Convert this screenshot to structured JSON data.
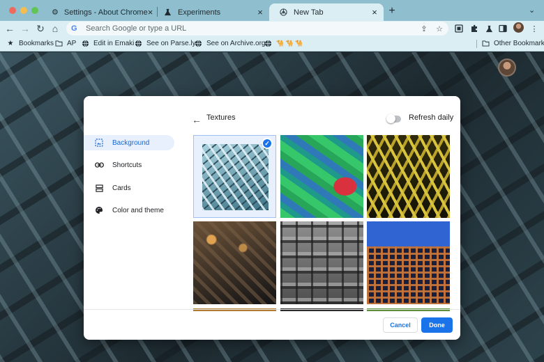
{
  "window": {
    "traffic_lights": {
      "close": "#ee6a5f",
      "minimize": "#f5bd4f",
      "zoom": "#61c454"
    }
  },
  "tabs": [
    {
      "label": "Settings - About Chrome",
      "icon": "gear-icon",
      "active": false
    },
    {
      "label": "Experiments",
      "icon": "flask-icon",
      "active": false
    },
    {
      "label": "New Tab",
      "icon": "chrome-globe-icon",
      "active": true
    }
  ],
  "toolbar": {
    "omnibox_placeholder": "Search Google or type a URL",
    "icons": [
      "back-icon",
      "forward-icon",
      "reload-icon",
      "home-icon",
      "google-g-icon",
      "share-icon",
      "star-icon",
      "extension-a-icon",
      "puzzle-icon",
      "labs-icon",
      "side-panel-icon",
      "avatar",
      "kebab-menu-icon"
    ]
  },
  "bookmarks": {
    "items": [
      {
        "label": "Bookmarks",
        "icon": "star-icon"
      },
      {
        "label": "AP",
        "icon": "folder-icon"
      },
      {
        "label": "Edit in Emaki",
        "icon": "globe-icon"
      },
      {
        "label": "See on Parse.ly",
        "icon": "globe-icon"
      },
      {
        "label": "See on Archive.org",
        "icon": "globe-icon"
      }
    ],
    "extra_glyphs": "🐪 🐪 🐪",
    "other": "Other Bookmarks"
  },
  "customize": {
    "section_title": "Textures",
    "refresh_daily_label": "Refresh daily",
    "refresh_daily_on": false,
    "menu": [
      {
        "label": "Background",
        "icon": "background-icon",
        "selected": true
      },
      {
        "label": "Shortcuts",
        "icon": "link-icon",
        "selected": false
      },
      {
        "label": "Cards",
        "icon": "cards-icon",
        "selected": false
      },
      {
        "label": "Color and theme",
        "icon": "palette-icon",
        "selected": false
      }
    ],
    "tiles": [
      {
        "name": "teal-lattice",
        "selected": true
      },
      {
        "name": "green-scales",
        "selected": false
      },
      {
        "name": "yellow-weave",
        "selected": false
      },
      {
        "name": "amber-lights",
        "selected": false
      },
      {
        "name": "grey-facade",
        "selected": false
      },
      {
        "name": "orange-grid-blue-sky",
        "selected": false
      }
    ],
    "cancel_label": "Cancel",
    "done_label": "Done",
    "accent": "#1a73e8"
  },
  "colors": {
    "tabstrip": "#8fbfce",
    "toolbar": "#dbeef3",
    "dialog": "#ffffff"
  }
}
